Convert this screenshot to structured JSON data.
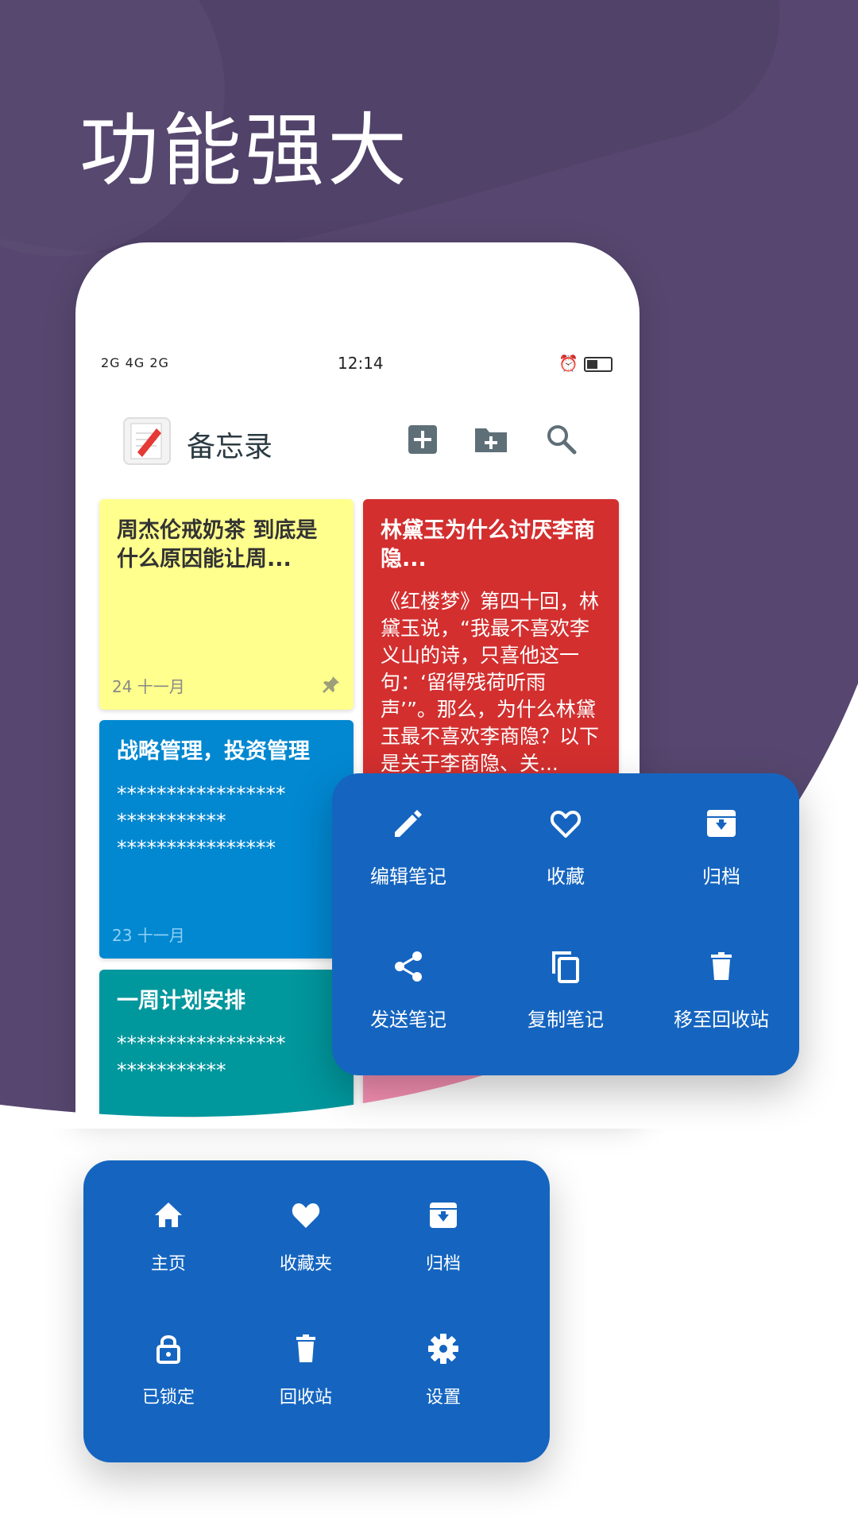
{
  "headline": "功能强大",
  "colors": {
    "background_purple": "#4f4066",
    "popup_blue": "#1565c0",
    "note_yellow": "#ffff8d",
    "note_red": "#d32f2f",
    "note_blue": "#0288d1",
    "note_teal": "#00979d"
  },
  "status_bar": {
    "signal": "2G 4G 2G",
    "time": "12:14",
    "battery_level": 0.45
  },
  "app_bar": {
    "title": "备忘录",
    "icons": [
      "add-note-icon",
      "new-folder-icon",
      "search-icon"
    ]
  },
  "notes": [
    {
      "title": "周杰伦戒奶茶  到底是什么原因能让周...",
      "body": "",
      "date": "24  十一月",
      "pinned": true,
      "color": "#ffff8d"
    },
    {
      "title": "林黛玉为什么讨厌李商隐...",
      "body": "《红楼梦》第四十回，林黛玉说，“我最不喜欢李义山的诗，只喜他这一句：‘留得残荷听雨声’”。那么，为什么林黛玉最不喜欢李商隐？以下是关于李商隐、关...",
      "date": "",
      "pinned": false,
      "color": "#d32f2f"
    },
    {
      "title": "战略管理，投资管理",
      "body": "*****************\n***********\n****************",
      "date": "23  十一月",
      "pinned": false,
      "color": "#0288d1"
    },
    {
      "title": "一周计划安排",
      "body": "*****************\n***********",
      "date": "",
      "pinned": false,
      "color": "#00979d"
    }
  ],
  "context_menu": {
    "items": [
      {
        "label": "编辑笔记",
        "icon": "pencil-icon"
      },
      {
        "label": "收藏",
        "icon": "heart-outline-icon"
      },
      {
        "label": "归档",
        "icon": "archive-icon"
      },
      {
        "label": "发送笔记",
        "icon": "share-icon"
      },
      {
        "label": "复制笔记",
        "icon": "copy-icon"
      },
      {
        "label": "移至回收站",
        "icon": "trash-icon"
      }
    ]
  },
  "nav_menu": {
    "items": [
      {
        "label": "主页",
        "icon": "home-icon"
      },
      {
        "label": "收藏夹",
        "icon": "heart-icon"
      },
      {
        "label": "归档",
        "icon": "archive-icon"
      },
      {
        "label": "已锁定",
        "icon": "lock-icon"
      },
      {
        "label": "回收站",
        "icon": "trash-icon"
      },
      {
        "label": "设置",
        "icon": "gear-icon"
      }
    ]
  }
}
